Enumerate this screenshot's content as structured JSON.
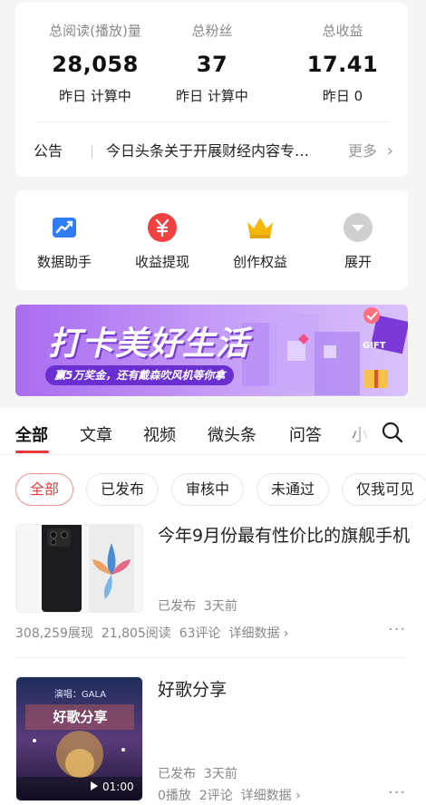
{
  "stats": {
    "items": [
      {
        "label": "总阅读(播放)量",
        "value": "28,058",
        "sub": "昨日 计算中"
      },
      {
        "label": "总粉丝",
        "value": "37",
        "sub": "昨日 计算中"
      },
      {
        "label": "总收益",
        "value": "17.41",
        "sub": "昨日 0"
      }
    ]
  },
  "notice": {
    "label": "公告",
    "text": "今日头条关于开展财经内容专…",
    "more": "更多"
  },
  "tools": [
    {
      "label": "数据助手",
      "icon": "chart-icon",
      "color": "#2f7df6"
    },
    {
      "label": "收益提现",
      "icon": "yen-icon",
      "color": "#f04142"
    },
    {
      "label": "创作权益",
      "icon": "crown-icon",
      "color": "#f5b70a"
    },
    {
      "label": "展开",
      "icon": "expand-icon",
      "color": "#c8c8c8"
    }
  ],
  "banner": {
    "title": "打卡美好生活",
    "subtitle": "赢5万奖金，还有戴森吹风机等你拿",
    "gift_text": "GIFT"
  },
  "tabs": [
    "全部",
    "文章",
    "视频",
    "微头条",
    "问答",
    "小"
  ],
  "filters": [
    "全部",
    "已发布",
    "审核中",
    "未通过",
    "仅我可见"
  ],
  "articles": [
    {
      "title": "今年9月份最有性价比的旗舰手机",
      "status": "已发布",
      "time": "3天前",
      "views": "308,259展现",
      "reads": "21,805阅读",
      "comments": "63评论",
      "detail": "详细数据"
    },
    {
      "title": "好歌分享",
      "status": "已发布",
      "time": "3天前",
      "views": "0播放",
      "comments": "2评论",
      "detail": "详细数据",
      "thumb_text": "好歌分享",
      "thumb_sub": "演唱：GALA",
      "duration": "01:00"
    }
  ],
  "colors": {
    "accent": "#e83a3a",
    "banner": "#a96cf0"
  }
}
